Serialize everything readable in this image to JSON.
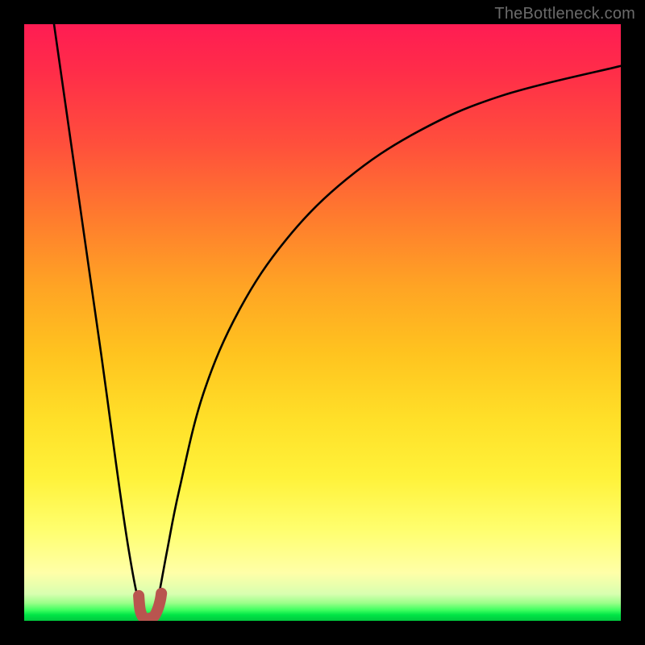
{
  "attribution": "TheBottleneck.com",
  "chart_data": {
    "type": "line",
    "title": "",
    "xlabel": "",
    "ylabel": "",
    "xlim": [
      0,
      100
    ],
    "ylim": [
      0,
      100
    ],
    "grid": false,
    "series": [
      {
        "name": "bottleneck-curve",
        "x": [
          5,
          7,
          9,
          11,
          13,
          14.5,
          16,
          17.5,
          19,
          20.5,
          21.5,
          22.5,
          24,
          26,
          30,
          36,
          44,
          54,
          66,
          80,
          100
        ],
        "y": [
          100,
          86,
          72,
          58,
          44,
          33,
          22,
          12,
          4,
          0,
          0,
          4,
          12,
          22,
          38,
          52,
          64,
          74,
          82,
          88,
          93
        ]
      },
      {
        "name": "minimum-marker",
        "x": [
          19.2,
          19.4,
          19.8,
          20.4,
          21.0,
          21.8,
          22.4,
          22.8,
          23.0
        ],
        "y": [
          4.2,
          2.0,
          0.8,
          0.4,
          0.4,
          0.8,
          2.0,
          3.4,
          4.6
        ]
      }
    ],
    "colors": {
      "curve": "#000000",
      "marker": "#b9554f",
      "gradient_top": "#ff1c53",
      "gradient_bottom": "#00c83e"
    }
  }
}
